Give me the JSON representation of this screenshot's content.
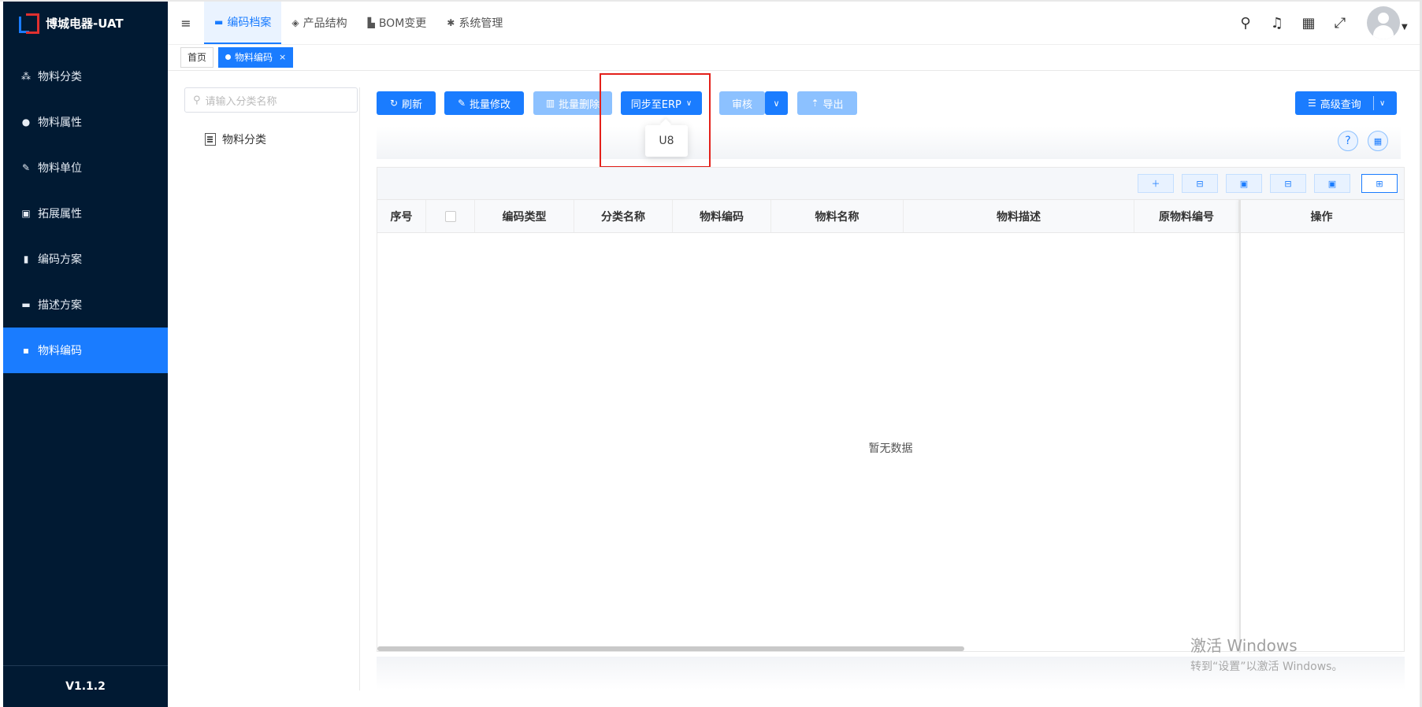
{
  "app": {
    "title": "博城电器-UAT",
    "version": "V1.1.2"
  },
  "sidebar": {
    "items": [
      {
        "label": "物料分类",
        "icon": "grid-icon"
      },
      {
        "label": "物料属性",
        "icon": "info-icon"
      },
      {
        "label": "物料单位",
        "icon": "hammer-icon"
      },
      {
        "label": "拓展属性",
        "icon": "image-icon"
      },
      {
        "label": "编码方案",
        "icon": "book-icon"
      },
      {
        "label": "描述方案",
        "icon": "monitor-icon"
      },
      {
        "label": "物料编码",
        "icon": "note-icon",
        "active": true
      }
    ]
  },
  "header": {
    "menus": [
      {
        "label": "编码档案",
        "active": true
      },
      {
        "label": "产品结构"
      },
      {
        "label": "BOM变更"
      },
      {
        "label": "系统管理"
      }
    ]
  },
  "tabs": [
    {
      "label": "首页"
    },
    {
      "label": "物料编码",
      "active": true,
      "close": "×"
    }
  ],
  "tree": {
    "search_placeholder": "请输入分类名称",
    "node": "物料分类"
  },
  "toolbar": {
    "refresh": "刷新",
    "batch_edit": "批量修改",
    "batch_delete": "批量删除",
    "sync_erp": "同步至ERP",
    "audit": "审核",
    "export": "导出",
    "advanced_query": "高级查询"
  },
  "dropdown": {
    "options": [
      "U8"
    ]
  },
  "table": {
    "columns": [
      "序号",
      "",
      "编码类型",
      "分类名称",
      "物料编码",
      "物料名称",
      "物料描述",
      "原物料编号",
      "操作"
    ],
    "empty_text": "暂无数据"
  },
  "watermark": {
    "line1": "激活 Windows",
    "line2": "转到“设置”以激活 Windows。"
  },
  "colors": {
    "sidebar_bg": "#011a33",
    "primary": "#1a7cff",
    "highlight": "#e3201a"
  }
}
